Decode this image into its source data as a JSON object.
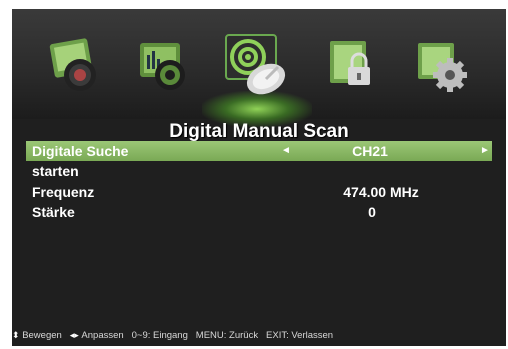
{
  "menu_icons": [
    {
      "name": "picture-icon"
    },
    {
      "name": "sound-icon"
    },
    {
      "name": "channel-search-icon",
      "selected": true
    },
    {
      "name": "lock-icon"
    },
    {
      "name": "settings-icon"
    }
  ],
  "title": "Digital Manual Scan",
  "rows": {
    "search": {
      "label": "Digitale Suche",
      "value": "CH21",
      "left_arrow": "◄",
      "right_arrow": "►"
    },
    "start": {
      "label": "starten"
    },
    "frequency": {
      "label": "Frequenz",
      "value": "474.00 MHz"
    },
    "strength": {
      "label": "Stärke",
      "value": "0"
    }
  },
  "footer": {
    "move": "Bewegen",
    "adjust": "Anpassen",
    "input": "0~9: Eingang",
    "back": "MENU: Zurück",
    "exit": "EXIT: Verlassen"
  },
  "colors": {
    "highlight": "#8fbd6b",
    "background": "#1f1f1f",
    "text": "#ffffff"
  }
}
